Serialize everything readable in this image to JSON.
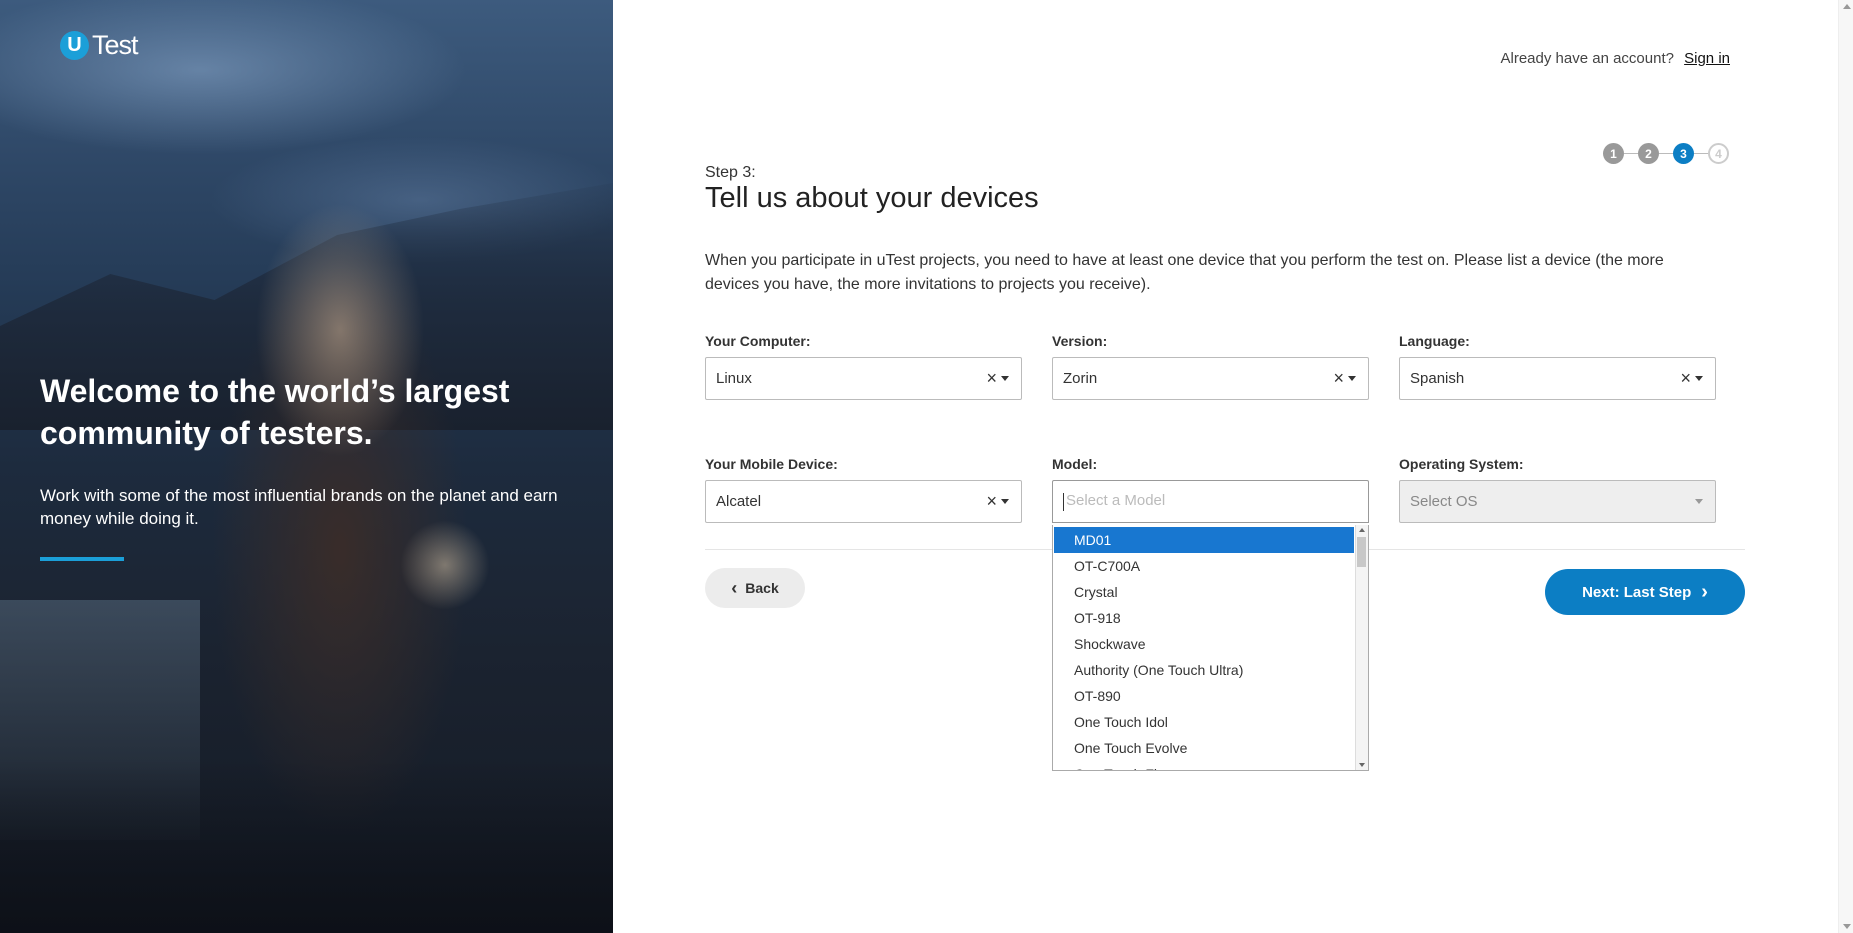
{
  "brand": {
    "logo_letter": "U",
    "logo_text": "Test"
  },
  "hero": {
    "title": "Welcome to the world’s largest community of testers.",
    "subtitle": "Work with some of the most influential brands on the planet and earn money while doing it."
  },
  "header": {
    "account_prompt": "Already have an account?",
    "sign_in": "Sign in"
  },
  "steps": [
    "1",
    "2",
    "3",
    "4"
  ],
  "current_step": 3,
  "step_label": "Step 3:",
  "page_title": "Tell us about your devices",
  "intro": "When you participate in uTest projects, you need to have at least one device that you perform the test on. Please list a device (the more devices you have, the more invitations to projects you receive).",
  "computer": {
    "label": "Your Computer:",
    "value": "Linux",
    "version_label": "Version:",
    "version_value": "Zorin",
    "language_label": "Language:",
    "language_value": "Spanish"
  },
  "mobile": {
    "label": "Your Mobile Device:",
    "value": "Alcatel",
    "model_label": "Model:",
    "model_placeholder": "Select a Model",
    "os_label": "Operating System:",
    "os_placeholder": "Select OS"
  },
  "model_options": [
    "MD01",
    "OT-C700A",
    "Crystal",
    "OT-918",
    "Shockwave",
    "Authority (One Touch Ultra)",
    "OT-890",
    "One Touch Idol",
    "One Touch Evolve",
    "One Touch Fire"
  ],
  "buttons": {
    "back": "Back",
    "next": "Next: Last Step"
  },
  "icons": {
    "clear": "×",
    "back_chevron": "‹",
    "next_chevron": "›"
  },
  "colors": {
    "accent": "#0c7ec4",
    "brand": "#1b9fd8",
    "highlight": "#1877d0"
  }
}
